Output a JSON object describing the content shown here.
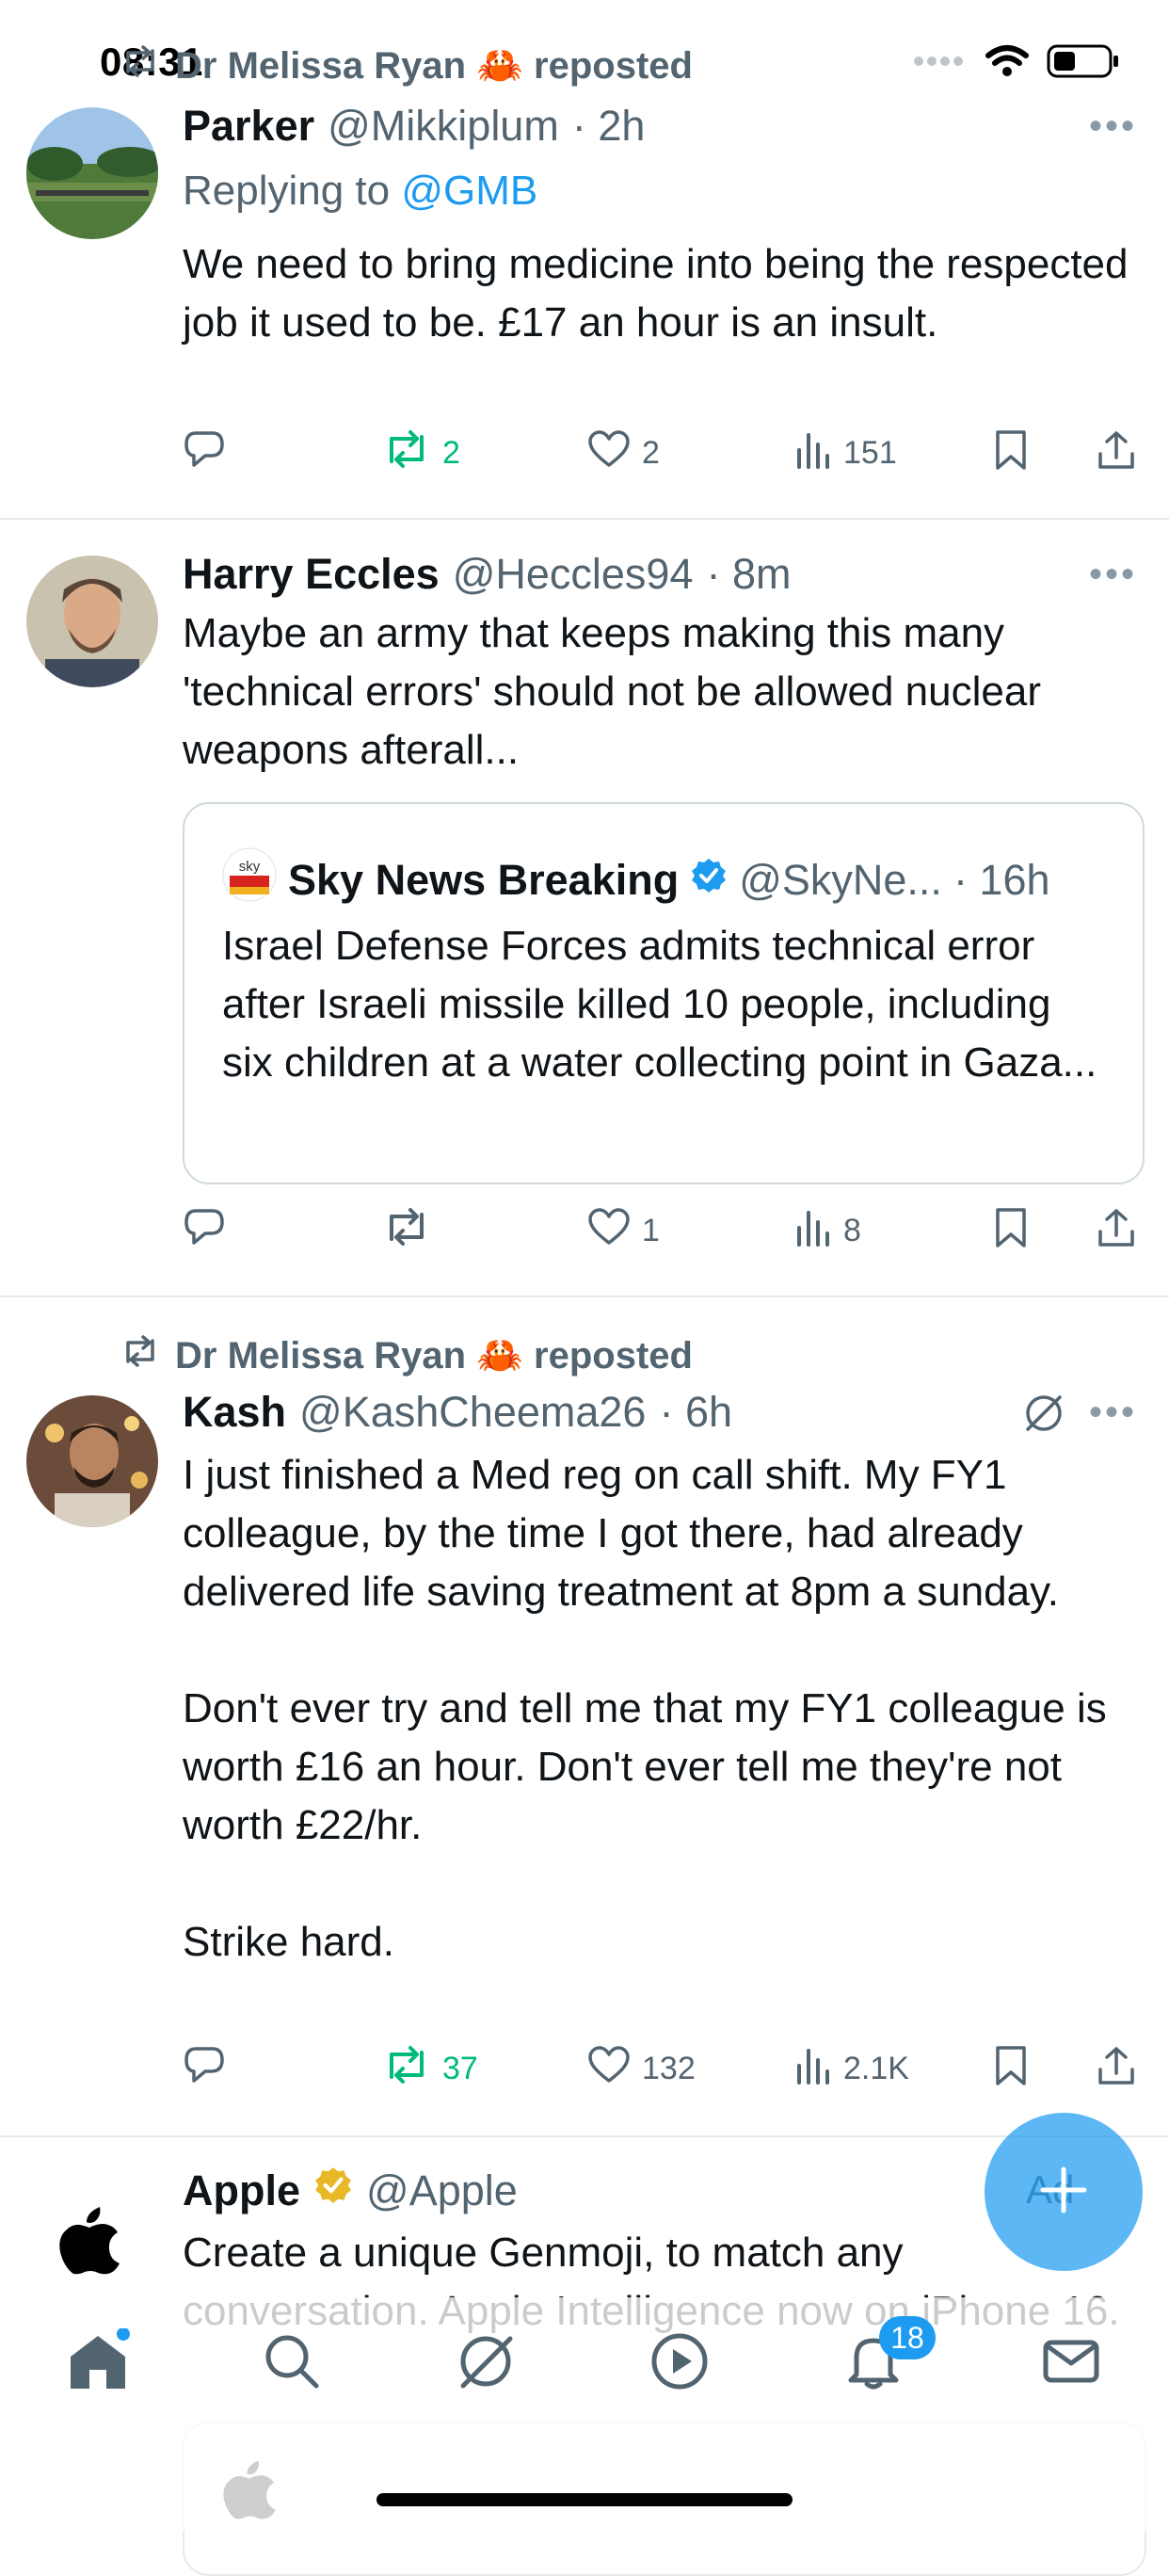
{
  "status_bar": {
    "time": "08:31"
  },
  "posts": [
    {
      "repost_by": "Dr Melissa Ryan 🦀 reposted",
      "name": "Parker",
      "handle": "@Mikkiplum",
      "time": "· 2h",
      "replying_prefix": "Replying to",
      "replying_handle": "@GMB",
      "text": "We need to bring medicine into being the respected job it used to be. £17 an hour is an insult.",
      "reposts": "2",
      "likes": "2",
      "views": "151"
    },
    {
      "name": "Harry Eccles",
      "handle": "@Heccles94",
      "time": "· 8m",
      "text": "Maybe an army that keeps making this many 'technical errors' should not be allowed nuclear weapons afterall...",
      "quote": {
        "avatar_text": "sky",
        "name": "Sky News Breaking",
        "handle": "@SkyNe...",
        "time": "· 16h",
        "text": "Israel Defense Forces admits technical error after Israeli missile killed 10 people, including six children at a water collecting point in Gaza..."
      },
      "likes": "1",
      "views": "8"
    },
    {
      "repost_by": "Dr Melissa Ryan 🦀 reposted",
      "name": "Kash",
      "handle": "@KashCheema26",
      "time": "· 6h",
      "text": "I just finished a Med reg on call shift. My FY1 colleague, by the time I got there, had already delivered life saving treatment at 8pm a sunday.\n\nDon't ever try and tell me that my FY1 colleague is worth £16 an hour. Don't ever tell me they're not worth £22/hr.\n\nStrike hard.",
      "reposts": "37",
      "likes": "132",
      "views": "2.1K"
    },
    {
      "name": "Apple",
      "handle": "@Apple",
      "ad_label": "Ad",
      "text": "Create a unique Genmoji, to match any conversation. Apple Intelligence now on iPhone 16."
    }
  ],
  "nav": {
    "notifications_badge": "18"
  },
  "colors": {
    "accent": "#1d9bf0",
    "repost_green": "#00ba7c",
    "secondary_text": "#536471"
  }
}
